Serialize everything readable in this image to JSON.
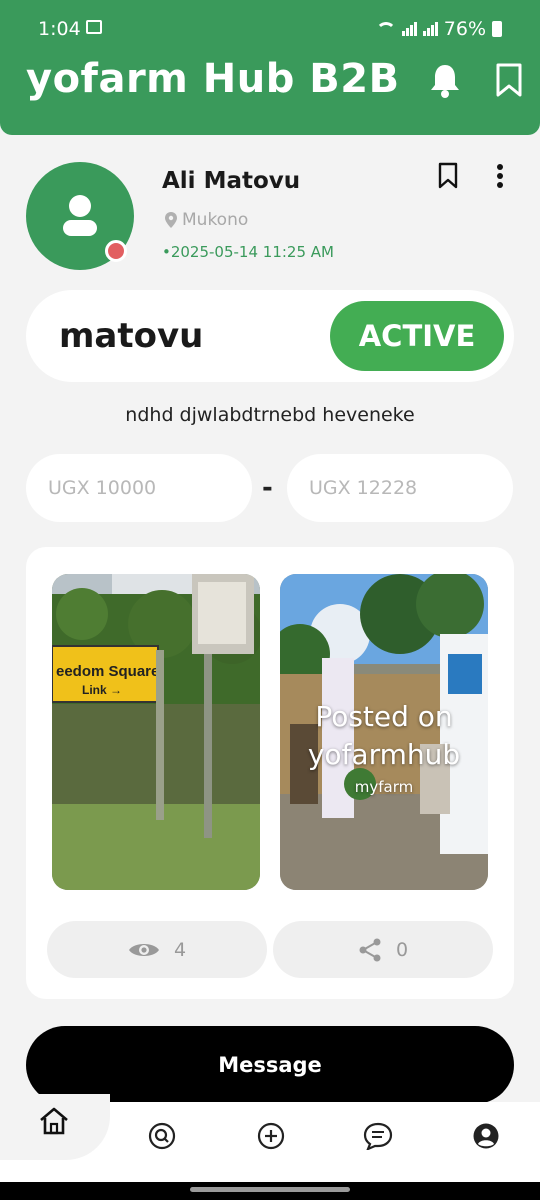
{
  "status_bar": {
    "time": "1:04",
    "battery": "76%"
  },
  "app": {
    "title": "yofarm Hub B2B"
  },
  "listing": {
    "user_name": "Ali Matovu",
    "location": "Mukono",
    "timestamp": "•2025-05-14 11:25 AM",
    "title": "matovu",
    "status": "ACTIVE",
    "description": "ndhd djwlabdtrnebd heveneke",
    "price_min": "UGX 10000",
    "price_separator": "-",
    "price_max": "UGX 12228",
    "overlay_text": "Posted on yofarmhub",
    "overlay_sub": "myfarm",
    "views": "4",
    "shares": "0"
  },
  "actions": {
    "message_label": "Message"
  },
  "colors": {
    "brand_green": "#3a9a5b",
    "active_green": "#43ad53",
    "online_dot": "#e25f61"
  },
  "icons": [
    "image-icon",
    "wifi-icon",
    "signal-icon",
    "battery-icon",
    "bell-icon",
    "bookmark-icon",
    "user-icon",
    "location-pin-icon",
    "more-vertical-icon",
    "eye-icon",
    "share-icon",
    "home-icon",
    "search-icon",
    "add-icon",
    "chat-icon",
    "profile-icon"
  ]
}
